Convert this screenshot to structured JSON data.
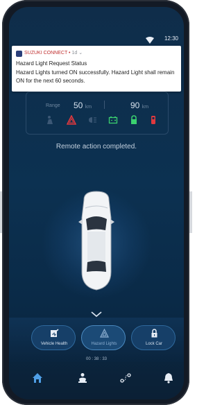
{
  "status_bar": {
    "time": "12:30",
    "icons": [
      "wifi-icon",
      "signal-icon"
    ]
  },
  "notification": {
    "app_name": "SUZUKI CONNECT",
    "time": "1d",
    "title": "Hazard Light Request Status",
    "body": "Hazard Lights turned ON successfully. Hazard Light shall remain ON for the next 60 seconds."
  },
  "dashboard": {
    "range_label": "Range",
    "range_value": "50",
    "range_unit": "km",
    "second_value": "90",
    "second_unit": "km",
    "icons": [
      "seatbelt-icon",
      "hazard-warning-icon",
      "headlight-icon",
      "battery-icon",
      "door-lock-icon",
      "door-alert-icon"
    ]
  },
  "remote_status": "Remote action completed.",
  "controls": [
    {
      "label": "Vehicle Health",
      "icon": "vehicle-health-icon",
      "active": false
    },
    {
      "label": "Hazard Lights",
      "icon": "hazard-icon",
      "active": true
    },
    {
      "label": "Lock Car",
      "icon": "lock-icon",
      "active": false
    }
  ],
  "timer": "00 : 38 : 33",
  "bottom_nav": [
    "home-icon",
    "driver-icon",
    "route-icon",
    "bell-icon"
  ],
  "colors": {
    "accent": "#2f6a9e",
    "background": "#0c3151",
    "hazard": "#e0393e",
    "ok": "#3bd16f"
  }
}
